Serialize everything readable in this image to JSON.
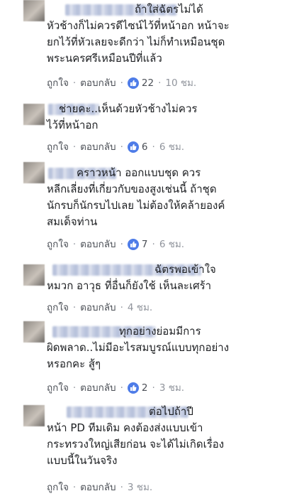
{
  "labels": {
    "like": "ถูกใจ",
    "reply": "ตอบกลับ",
    "dot": "·"
  },
  "colors": {
    "link": "#4b4f56",
    "meta": "#90949c",
    "like_badge": "#4e7ce8"
  },
  "comments": [
    {
      "lines": [
        "ถ้าใส่ฉัตรไม่ได้",
        "หัวช้างก็ไม่ควรดีไซน์ไว้ที่หน้าอก หน้าจะ",
        "ยกไว้ที่หัวเลยจะดีกว่า ไม่ก็ทำเหมือนชุด",
        "พระนครศรีเหมือนปีที่แล้ว"
      ],
      "reactions": "22",
      "time": "10 ชม."
    },
    {
      "lines": [
        "ช่ายคะ..เห็นด้วยหัวช้างไม่ควร",
        "ไว้ที่หน้าอก"
      ],
      "reactions": "6",
      "time": "6 ชม."
    },
    {
      "lines": [
        "คราวหน้า ออกแบบชุด ควร",
        "หลีกเลี่ยงที่เกี่ยวกับของสูงเช่นนี้ ถ้าชุด",
        "นักรบก็นักรบไปเลย ไม่ต้องให้คล้ายองค์",
        "สมเด็จท่าน"
      ],
      "reactions": "7",
      "time": "6 ชม."
    },
    {
      "lines": [
        "ฉัตรพอเข้าใจ",
        "หมวก อาวุธ ที่อื่นก็ยังใช้ เห็นละเศร้า"
      ],
      "reactions": "",
      "time": "4 ชม."
    },
    {
      "lines": [
        "ทุกอย่างย่อมมีการ",
        "ผิดพลาด..ไม่มีอะไรสมบูรณ์แบบทุกอย่าง",
        "หรอกคะ สู้ๆ"
      ],
      "reactions": "2",
      "time": "3 ชม."
    },
    {
      "lines": [
        "ต่อไปถ้าปี",
        "หน้า PD ทีมเดิม คงต้องส่งแบบเข้า",
        "กระทรวงใหญ่เสียก่อน จะได้ไม่เกิดเรื่อง",
        "แบบนี้ในวันจริง"
      ],
      "reactions": "",
      "time": "3 ชม."
    }
  ]
}
